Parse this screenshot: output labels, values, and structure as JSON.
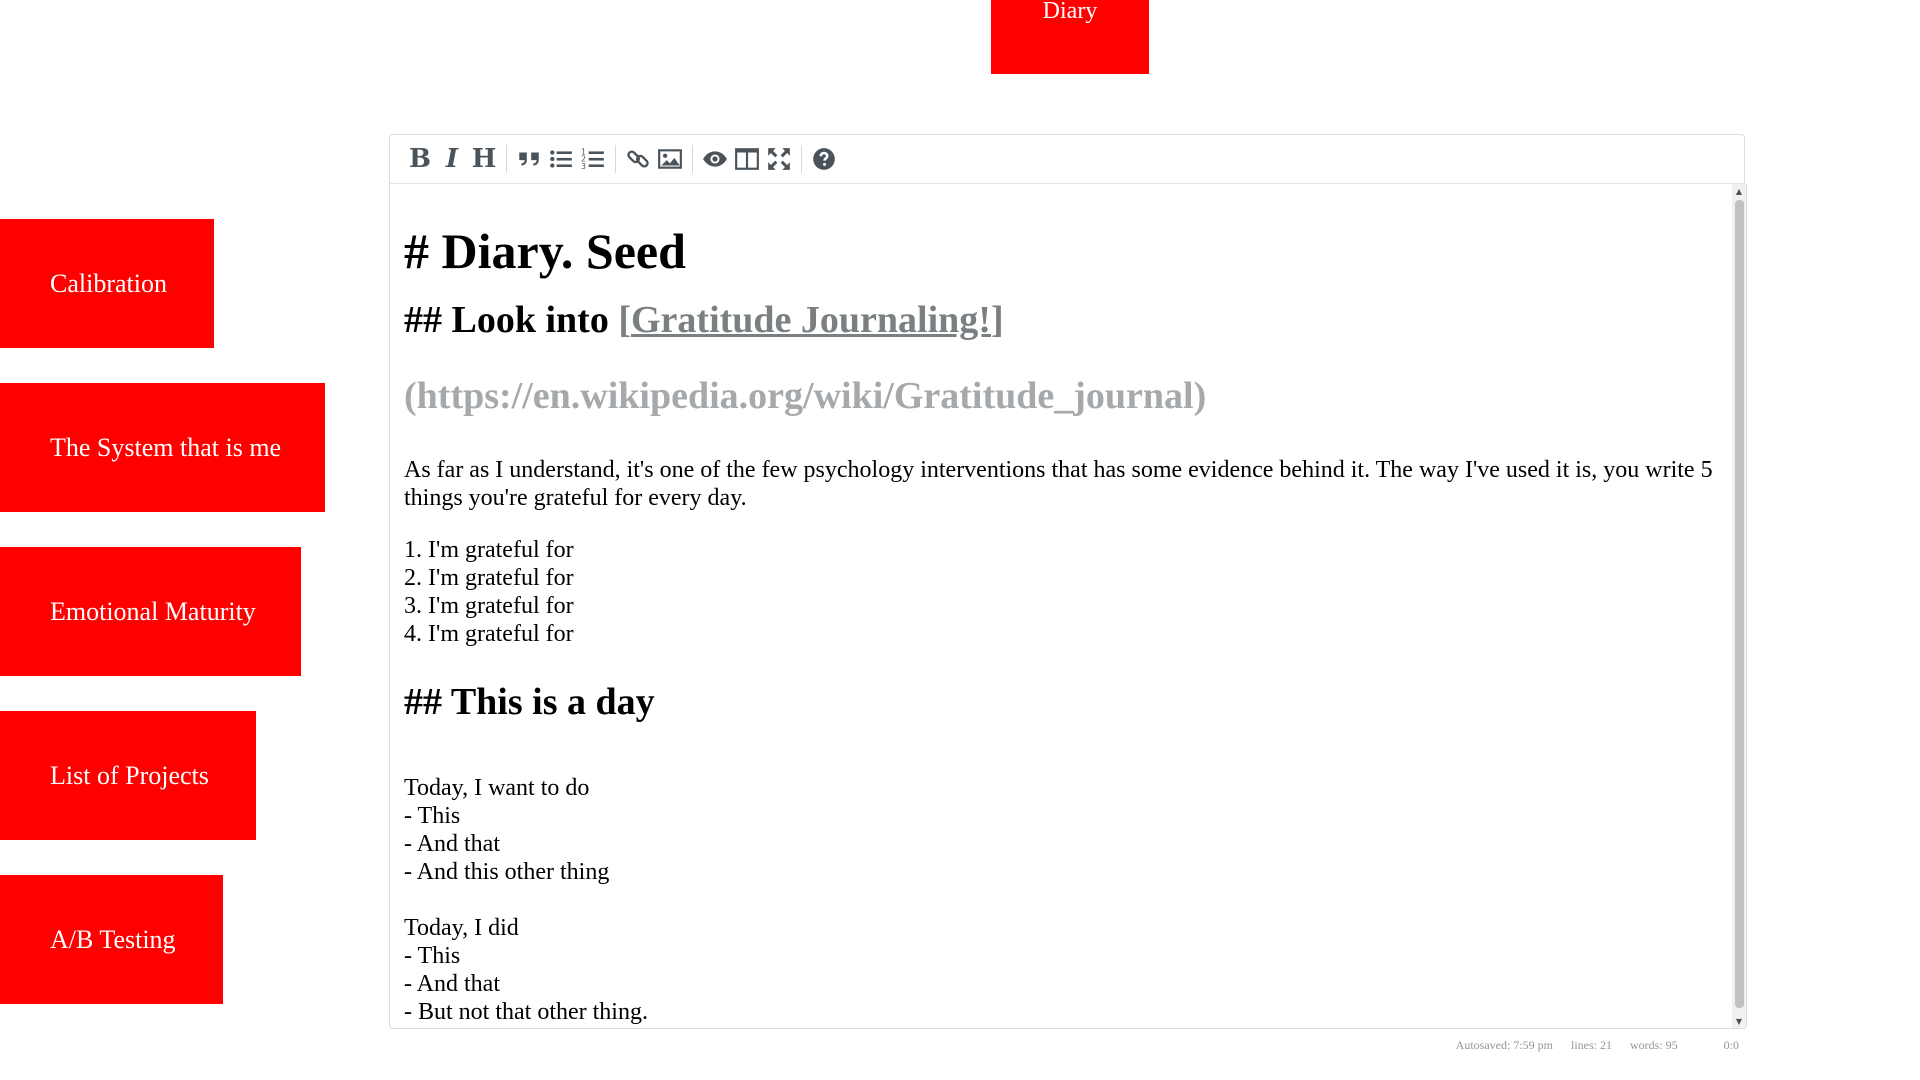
{
  "top_tab": {
    "label": "Diary"
  },
  "sidebar": {
    "items": [
      {
        "label": "Calibration"
      },
      {
        "label": "The System that is me"
      },
      {
        "label": "Emotional Maturity"
      },
      {
        "label": "List of Projects"
      },
      {
        "label": "A/B Testing"
      }
    ]
  },
  "toolbar": {
    "bold_label": "B",
    "italic_label": "I",
    "heading_label": "H",
    "icons": [
      "quote-icon",
      "unordered-list-icon",
      "ordered-list-icon",
      "link-icon",
      "image-icon",
      "preview-icon",
      "side-by-side-icon",
      "fullscreen-icon",
      "help-icon"
    ]
  },
  "document": {
    "h1": "# Diary. Seed",
    "h2a_prefix": "## Look into ",
    "h2a_link_open": "[",
    "h2a_link_text": "Gratitude Journaling!",
    "h2a_link_close": "]",
    "h2a_url": "(https://en.wikipedia.org/wiki/Gratitude_journal)",
    "paragraph": "As far as I understand, it's one of the few psychology interventions that has some evidence behind it. The way I've used it is, you write 5 things you're grateful for every day.",
    "grateful_list": [
      "1. I'm grateful for",
      "2. I'm grateful for",
      "3. I'm grateful for",
      "4. I'm grateful for"
    ],
    "h2b": "## This is a day",
    "want_heading": "Today, I want to do",
    "want_list": [
      "- This",
      "- And that",
      "- And this other thing"
    ],
    "did_heading": "Today, I did",
    "did_list": [
      "- This",
      "- And that",
      "- But not that other thing."
    ]
  },
  "statusbar": {
    "autosave": "Autosaved: 7:59 pm",
    "lines": "lines: 21",
    "words": "words: 95",
    "cursor": "0:0"
  }
}
